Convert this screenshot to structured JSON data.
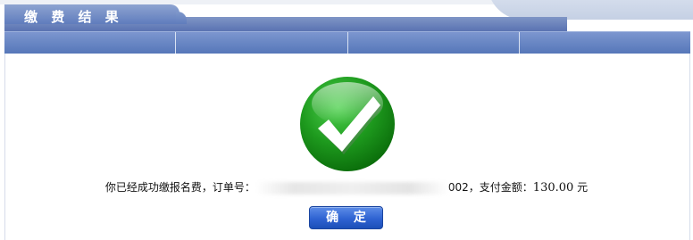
{
  "header": {
    "title": "缴 费 结 果",
    "columns": [
      "",
      "",
      "",
      ""
    ]
  },
  "result": {
    "icon": "check-circle-icon",
    "message_prefix": "你已经成功缴报名费，订单号：",
    "order_number_redacted": "002",
    "message_suffix": "，支付金额：",
    "amount": "130.00",
    "currency": "元"
  },
  "actions": {
    "confirm_label": "确 定"
  },
  "colors": {
    "header_blue": "#5f7cbd",
    "success_green": "#1e9a1e",
    "button_blue": "#2f63d2"
  }
}
